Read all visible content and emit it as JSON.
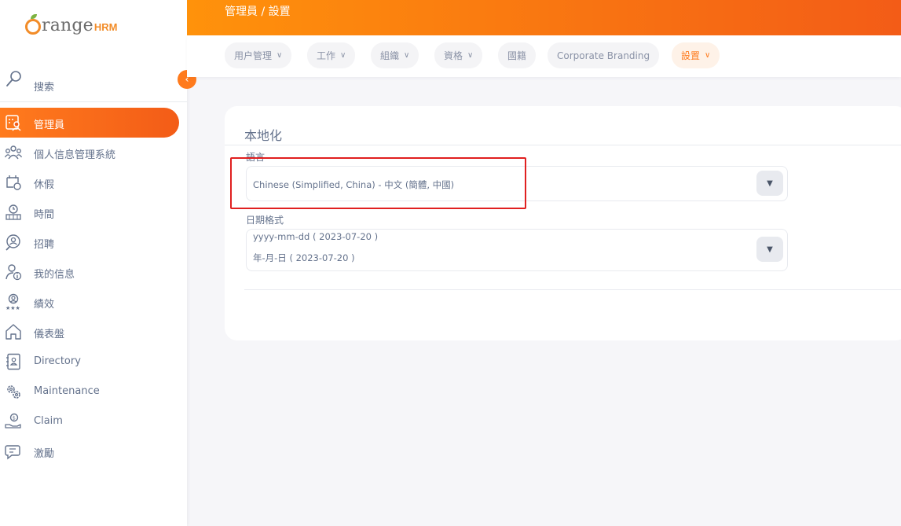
{
  "logo": {
    "text": "range",
    "suffix": "HRM"
  },
  "sidebar": {
    "search_label": "搜索",
    "items": [
      {
        "label": "管理員",
        "icon": "admin-icon",
        "active": true
      },
      {
        "label": "個人信息管理系統",
        "icon": "people-icon"
      },
      {
        "label": "休假",
        "icon": "leave-icon"
      },
      {
        "label": "時間",
        "icon": "time-icon"
      },
      {
        "label": "招聘",
        "icon": "recruit-icon"
      },
      {
        "label": "我的信息",
        "icon": "my-info-icon"
      },
      {
        "label": "績效",
        "icon": "performance-icon"
      },
      {
        "label": "儀表盤",
        "icon": "dashboard-icon"
      },
      {
        "label": "Directory",
        "icon": "directory-icon"
      },
      {
        "label": "Maintenance",
        "icon": "maintenance-icon"
      },
      {
        "label": "Claim",
        "icon": "claim-icon"
      },
      {
        "label": "激勵",
        "icon": "buzz-icon"
      }
    ]
  },
  "header": {
    "breadcrumb": "管理員 / 設置"
  },
  "tabs": [
    {
      "label": "用户管理",
      "dropdown": true
    },
    {
      "label": "工作",
      "dropdown": true
    },
    {
      "label": "組織",
      "dropdown": true
    },
    {
      "label": "資格",
      "dropdown": true
    },
    {
      "label": "國籍",
      "dropdown": false
    },
    {
      "label": "Corporate Branding",
      "dropdown": false
    },
    {
      "label": "設置",
      "dropdown": true,
      "active": true
    }
  ],
  "card": {
    "title": "本地化",
    "language_label": "語言",
    "language_value": "Chinese (Simplified, China) - 中文 (簡體, 中國)",
    "date_format_label": "日期格式",
    "date_format_hint": "yyyy-mm-dd ( 2023-07-20 )",
    "date_format_value": "年-月-日 ( 2023-07-20 )"
  },
  "colors": {
    "accent": "#ff7b1d",
    "highlight_box": "#e02020"
  }
}
